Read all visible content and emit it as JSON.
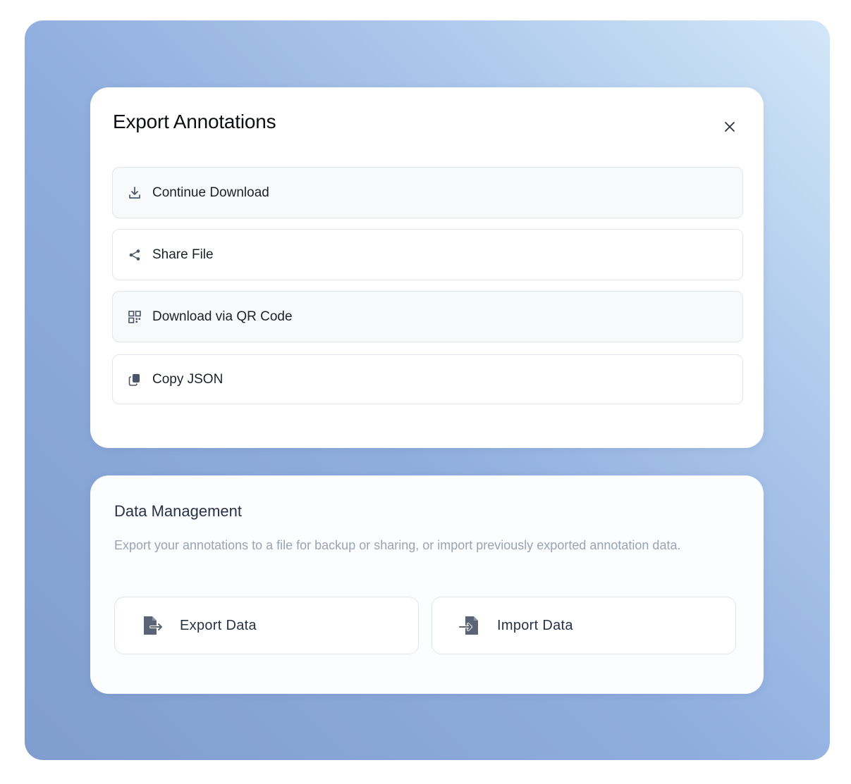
{
  "export_dialog": {
    "title": "Export Annotations",
    "close_icon": "close-icon",
    "options": [
      {
        "label": "Continue Download",
        "icon": "download-icon"
      },
      {
        "label": "Share File",
        "icon": "share-icon"
      },
      {
        "label": "Download via QR Code",
        "icon": "qr-code-icon"
      },
      {
        "label": "Copy JSON",
        "icon": "copy-icon"
      }
    ]
  },
  "data_management": {
    "title": "Data Management",
    "description": "Export your annotations to a file for backup or sharing, or import previously exported annotation data.",
    "export_button": {
      "label": "Export Data",
      "icon": "file-export-icon"
    },
    "import_button": {
      "label": "Import Data",
      "icon": "file-import-icon"
    }
  },
  "colors": {
    "backdrop_start": "#d2e7f8",
    "backdrop_end": "#809dcf",
    "icon": "#4b5568",
    "text": "#1c2129",
    "muted_text": "#9aa3b3"
  }
}
